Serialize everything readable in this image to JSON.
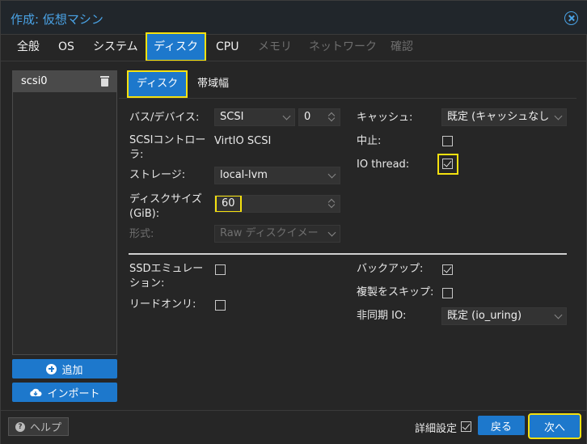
{
  "window": {
    "title": "作成: 仮想マシン"
  },
  "tabs": [
    {
      "label": "全般",
      "state": "normal"
    },
    {
      "label": "OS",
      "state": "normal"
    },
    {
      "label": "システム",
      "state": "normal"
    },
    {
      "label": "ディスク",
      "state": "active"
    },
    {
      "label": "CPU",
      "state": "normal"
    },
    {
      "label": "メモリ",
      "state": "disabled"
    },
    {
      "label": "ネットワーク",
      "state": "disabled"
    },
    {
      "label": "確認",
      "state": "disabled"
    }
  ],
  "disk_list": {
    "items": [
      {
        "label": "scsi0"
      }
    ]
  },
  "side_buttons": {
    "add": "追加",
    "import": "インポート"
  },
  "subtabs": [
    {
      "label": "ディスク",
      "state": "active"
    },
    {
      "label": "帯域幅",
      "state": "normal"
    }
  ],
  "form": {
    "bus_device": {
      "label": "バス/デバイス:",
      "bus": "SCSI",
      "index": "0"
    },
    "scsi_controller": {
      "label": "SCSIコントローラ:",
      "value": "VirtIO SCSI"
    },
    "storage": {
      "label": "ストレージ:",
      "value": "local-lvm"
    },
    "disk_size": {
      "label": "ディスクサイズ (GiB):",
      "value": "60"
    },
    "format": {
      "label": "形式:",
      "value": "Raw ディスクイメー"
    },
    "cache": {
      "label": "キャッシュ:",
      "value": "既定 (キャッシュなし"
    },
    "discard": {
      "label": "中止:",
      "checked": false
    },
    "io_thread": {
      "label": "IO thread:",
      "checked": true
    },
    "ssd_emulation": {
      "label": "SSDエミュレーション:",
      "checked": false
    },
    "read_only": {
      "label": "リードオンリ:",
      "checked": false
    },
    "backup": {
      "label": "バックアップ:",
      "checked": true
    },
    "skip_replication": {
      "label": "複製をスキップ:",
      "checked": false
    },
    "async_io": {
      "label": "非同期 IO:",
      "value": "既定 (io_uring)"
    }
  },
  "footer": {
    "help": "ヘルプ",
    "advanced": "詳細設定",
    "advanced_checked": true,
    "back": "戻る",
    "next": "次へ"
  },
  "colors": {
    "accent": "#1d78cc",
    "highlight": "#f5e10f",
    "title": "#4aa3e6"
  }
}
